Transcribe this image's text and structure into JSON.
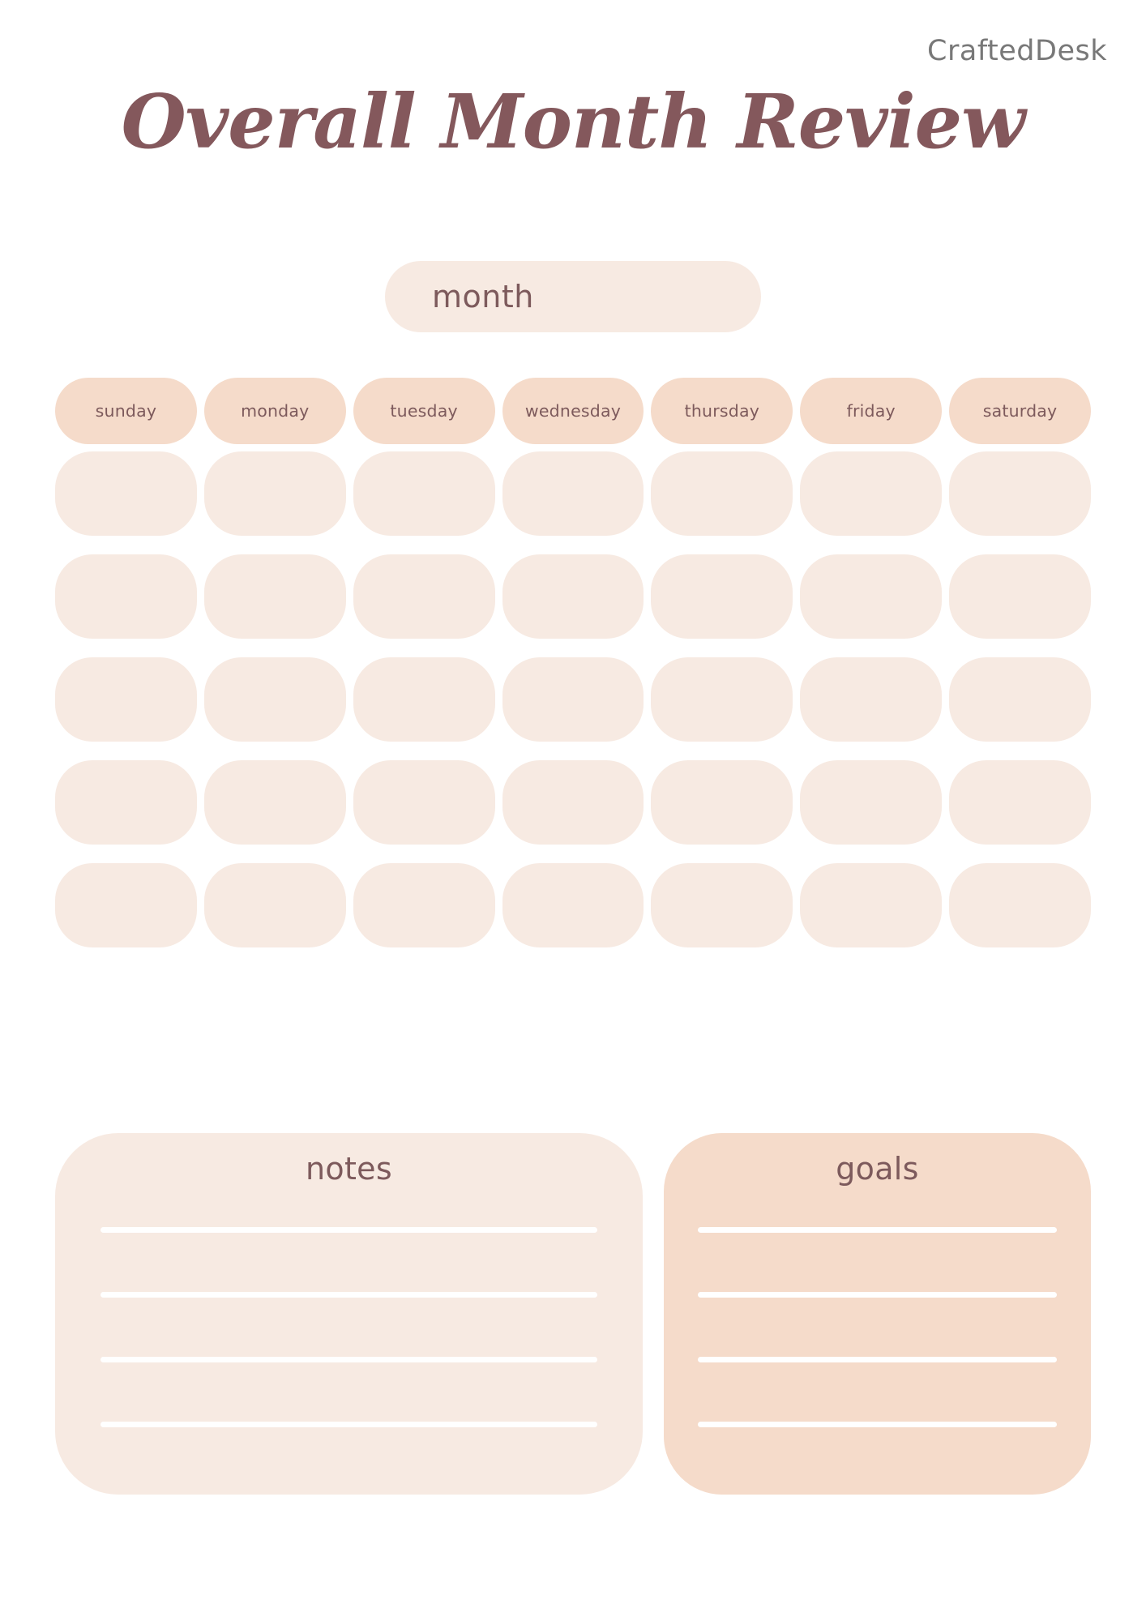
{
  "brand": {
    "name": "CraftedDesk"
  },
  "header": {
    "title": "Overall Month Review"
  },
  "month_field": {
    "label": "month",
    "value": ""
  },
  "calendar": {
    "weekdays": [
      "sunday",
      "monday",
      "tuesday",
      "wednesday",
      "thursday",
      "friday",
      "saturday"
    ],
    "rows": 5,
    "columns": 7,
    "day_cells": [
      "",
      "",
      "",
      "",
      "",
      "",
      "",
      "",
      "",
      "",
      "",
      "",
      "",
      "",
      "",
      "",
      "",
      "",
      "",
      "",
      "",
      "",
      "",
      "",
      "",
      "",
      "",
      "",
      "",
      "",
      "",
      "",
      "",
      "",
      ""
    ]
  },
  "panels": [
    {
      "id": "notes",
      "title": "notes",
      "lines": [
        "",
        "",
        "",
        ""
      ]
    },
    {
      "id": "goals",
      "title": "goals",
      "lines": [
        "",
        "",
        "",
        ""
      ]
    }
  ],
  "colors": {
    "page_background": "#ffffff",
    "title_text": "#84585c",
    "brand_text": "#787878",
    "cream_fill": "#f7eae2",
    "peach_fill": "#f5dbca",
    "label_text": "#7d5a5c",
    "rule_line": "#ffffff"
  }
}
